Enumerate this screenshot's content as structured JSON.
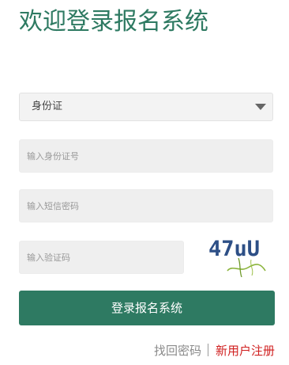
{
  "header": {
    "title": "欢迎登录报名系统"
  },
  "form": {
    "id_type": {
      "selected": "身份证"
    },
    "id_number": {
      "placeholder": "输入身份证号",
      "value": ""
    },
    "sms_password": {
      "placeholder": "输入短信密码",
      "value": ""
    },
    "captcha_input": {
      "placeholder": "输入验证码",
      "value": ""
    },
    "captcha_image_text": "47uU",
    "submit_label": "登录报名系统"
  },
  "footer_links": {
    "forgot_password": "找回密码",
    "register": "新用户注册"
  },
  "colors": {
    "brand_green": "#2e7a62",
    "register_red": "#d02020",
    "captcha_blue": "#2d4f86"
  }
}
